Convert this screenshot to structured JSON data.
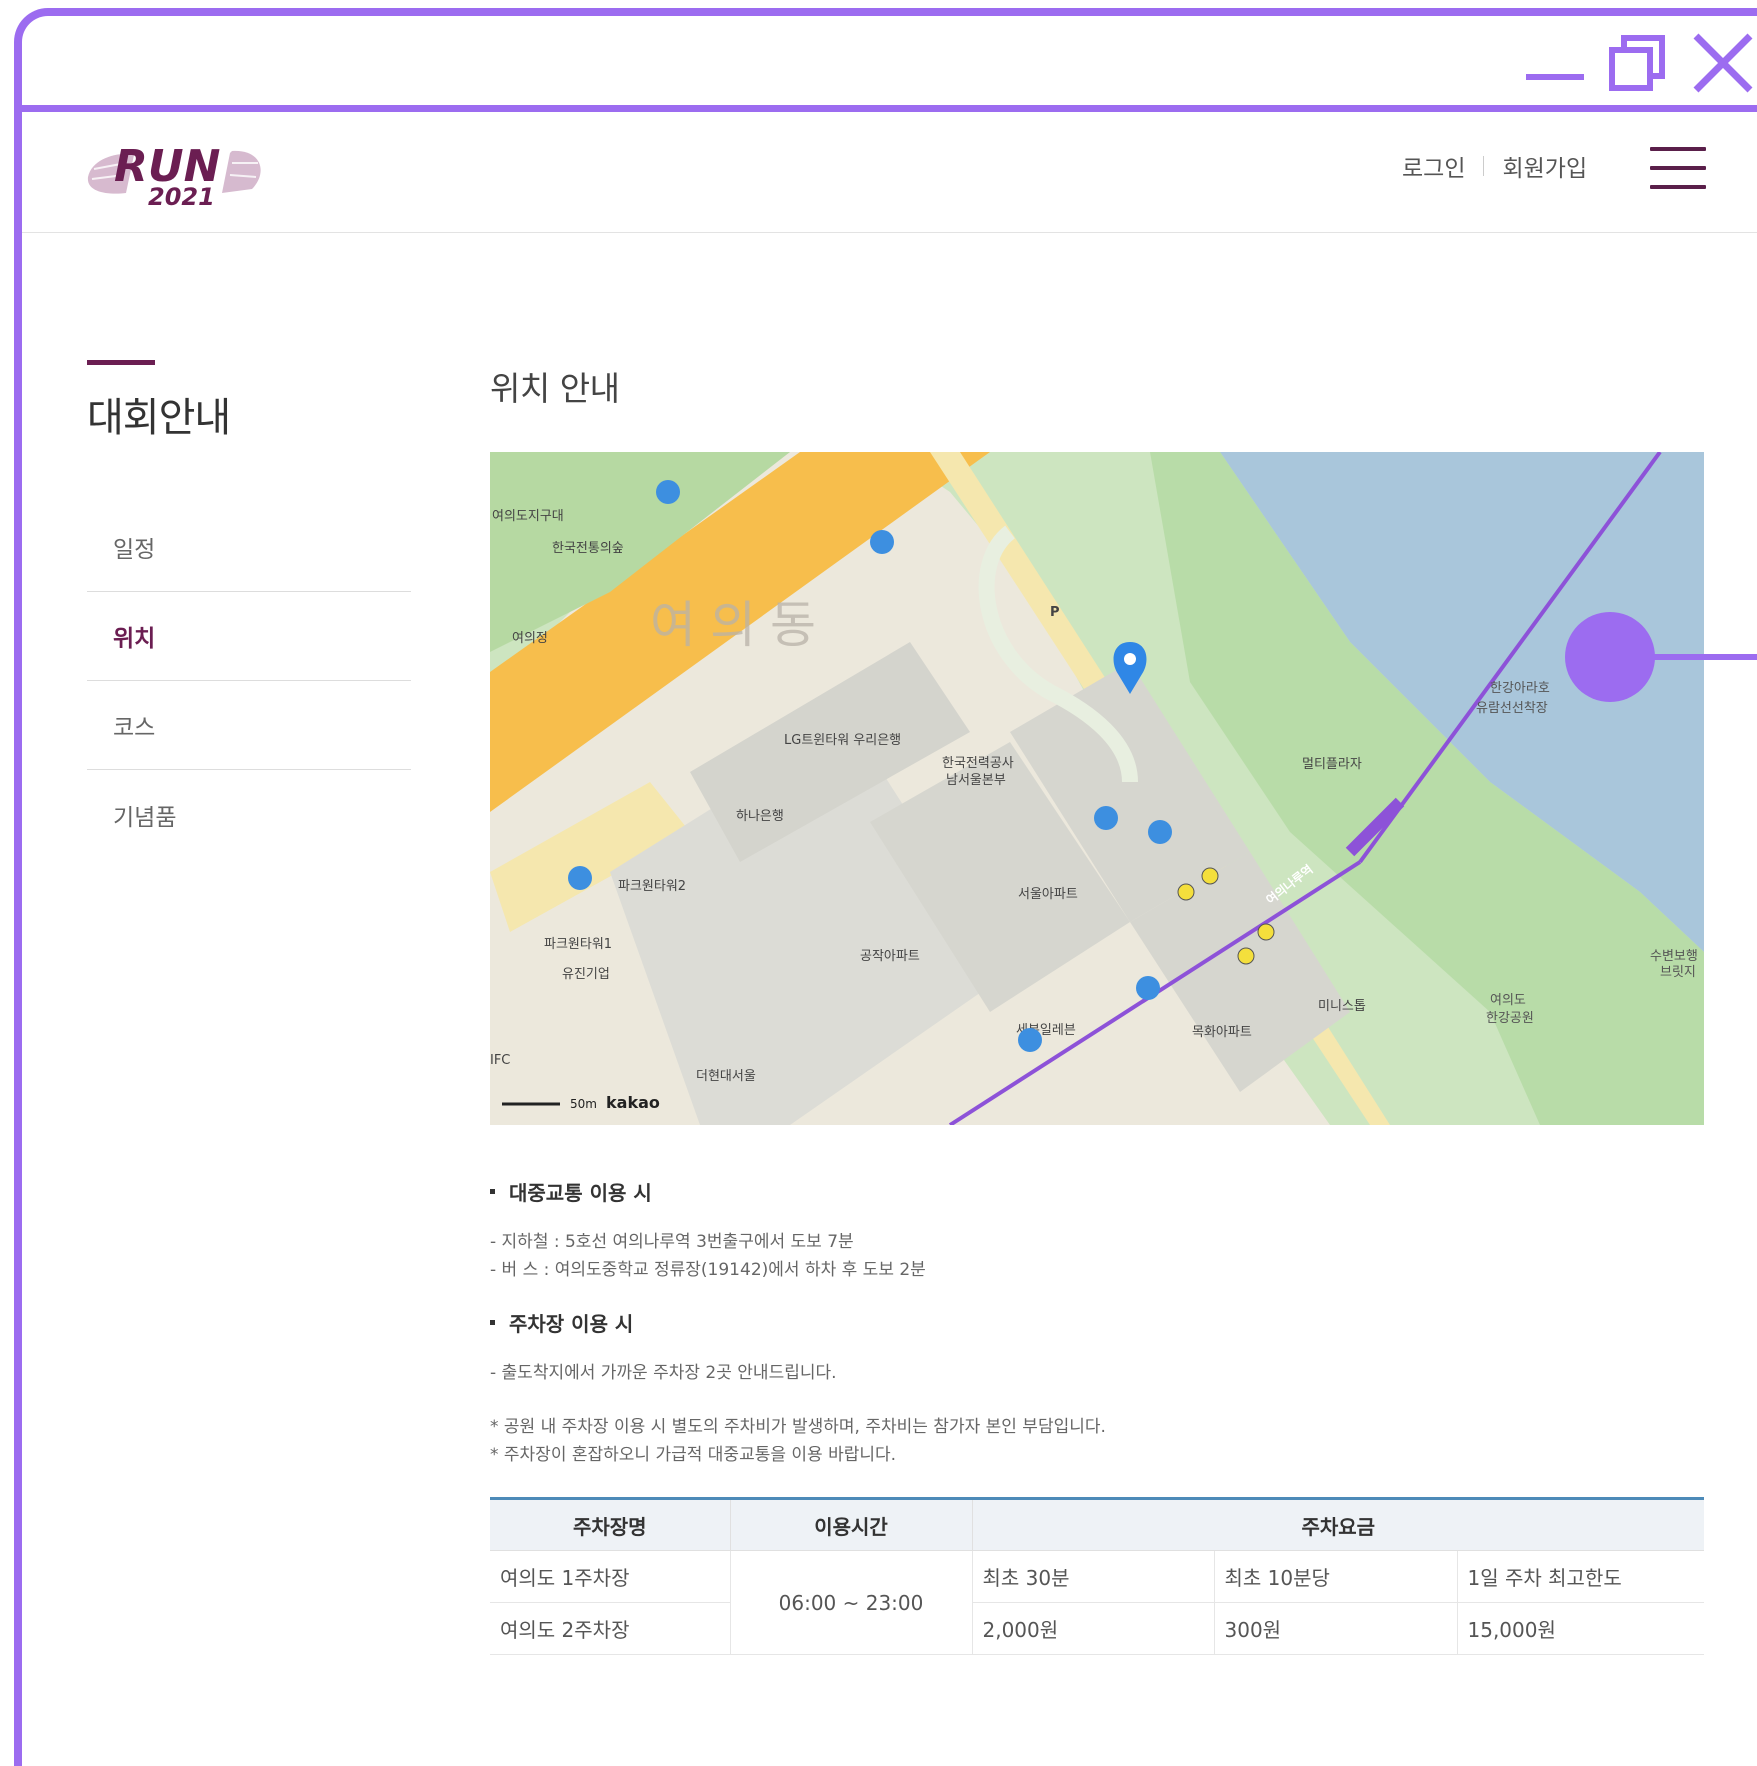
{
  "colors": {
    "frame": "#9c6cf0",
    "brand": "#6b1e52",
    "table_accent": "#4d8ab8"
  },
  "window": {
    "controls": [
      "minimize-icon",
      "restore-icon",
      "close-icon"
    ]
  },
  "header": {
    "logo_text": "RUN",
    "logo_year": "2021",
    "login_label": "로그인",
    "signup_label": "회원가입",
    "menu_icon": "hamburger-menu-icon"
  },
  "sidebar": {
    "title": "대회안내",
    "items": [
      {
        "label": "일정",
        "active": false
      },
      {
        "label": "위치",
        "active": true
      },
      {
        "label": "코스",
        "active": false
      },
      {
        "label": "기념품",
        "active": false
      }
    ]
  },
  "main": {
    "title": "위치 안내",
    "map": {
      "district_label": "여의동",
      "labels": {
        "a": "여의도지구대",
        "b": "한국전통의숲",
        "c": "여의정",
        "d": "LG트윈타워 우리은행",
        "e": "한국전력공사",
        "f": "남서울본부",
        "g": "하나은행",
        "h": "파크원타워2",
        "i": "파크원타워1",
        "j": "유진기업",
        "k": "더현대서울",
        "l": "공작아파트",
        "m": "서울아파트",
        "n": "세븐일레븐",
        "o": "목화아파트",
        "p": "미니스톱",
        "q": "한강아라호",
        "r": "유람선선착장",
        "s": "멀티플라자",
        "t": "여의나루역",
        "u": "여의도",
        "v": "한강공원",
        "w": "수변보행",
        "x": "브릿지",
        "y": "kakao",
        "z": "50m",
        "aa": "IFC",
        "ab": "P"
      }
    },
    "transit": {
      "heading": "대중교통 이용 시",
      "lines": [
        "- 지하철 : 5호선 여의나루역 3번출구에서 도보 7분",
        "- 버 스 : 여의도중학교 정류장(19142)에서 하차 후 도보 2분"
      ]
    },
    "parking": {
      "heading": "주차장 이용 시",
      "lines": [
        "- 출도착지에서 가까운 주차장 2곳 안내드립니다."
      ],
      "notes": [
        "* 공원 내 주차장 이용 시 별도의 주차비가 발생하며, 주차비는 참가자 본인 부담입니다.",
        "* 주차장이 혼잡하오니 가급적 대중교통을 이용 바랍니다."
      ],
      "table": {
        "headers": [
          "주차장명",
          "이용시간",
          "주차요금"
        ],
        "hours": "06:00 ~ 23:00",
        "rows": [
          [
            "여의도 1주차장",
            "최초 30분",
            "최초 10분당",
            "1일 주차 최고한도"
          ],
          [
            "여의도 2주차장",
            "2,000원",
            "300원",
            "15,000원"
          ]
        ]
      }
    }
  }
}
